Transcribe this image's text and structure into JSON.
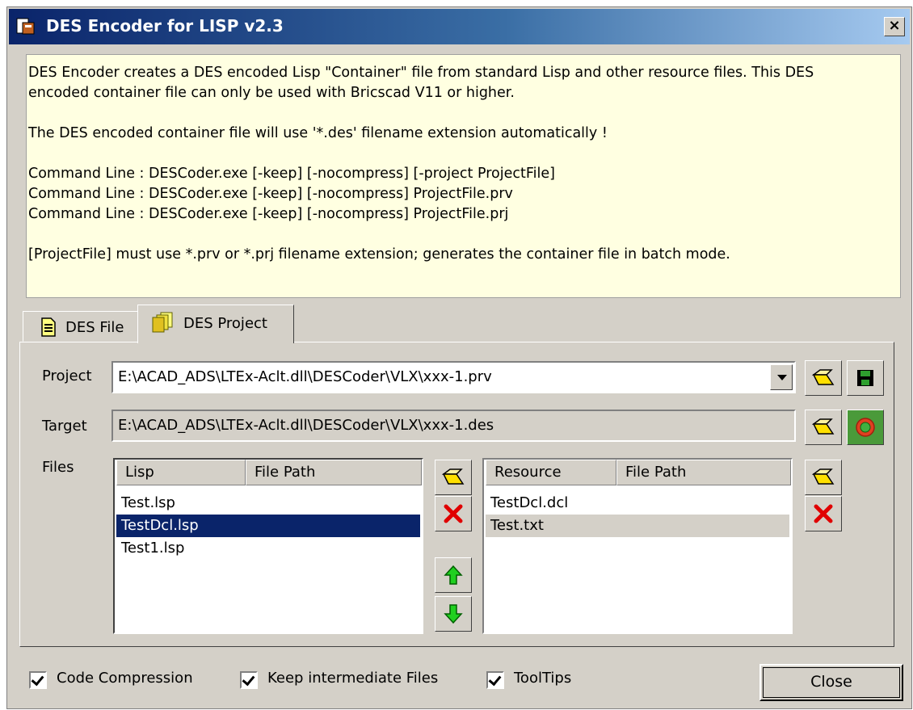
{
  "window": {
    "title": "DES Encoder for LISP v2.3",
    "close_glyph": "×"
  },
  "info": {
    "lines": [
      "DES Encoder creates a DES encoded Lisp \"Container\" file from standard Lisp and other resource files. This DES",
      "encoded container file can only be used with Bricscad V11 or higher.",
      "The DES encoded container file will use '*.des' filename extension automatically !",
      "Command Line : DESCoder.exe [-keep] [-nocompress] [-project  ProjectFile]",
      "Command Line : DESCoder.exe [-keep] [-nocompress] ProjectFile.prv",
      "Command Line : DESCoder.exe [-keep] [-nocompress] ProjectFile.prj",
      "[ProjectFile] must use *.prv or *.prj filename extension; generates the container file in batch mode."
    ]
  },
  "tabs": [
    {
      "label": "DES File",
      "icon": "document-icon",
      "active": false
    },
    {
      "label": "DES Project",
      "icon": "stacked-files-icon",
      "active": true
    }
  ],
  "project": {
    "project_label": "Project",
    "project_value": "E:\\ACAD_ADS\\LTEx-Aclt.dll\\DESCoder\\VLX\\xxx-1.prv",
    "target_label": "Target",
    "target_value": "E:\\ACAD_ADS\\LTEx-Aclt.dll\\DESCoder\\VLX\\xxx-1.des",
    "files_label": "Files"
  },
  "lisp_list": {
    "headers": [
      "Lisp",
      "File Path"
    ],
    "rows": [
      "Test.lsp",
      "TestDcl.lsp",
      "Test1.lsp"
    ],
    "selected_row": "TestDcl.lsp"
  },
  "resource_list": {
    "headers": [
      "Resource",
      "File Path"
    ],
    "rows": [
      "TestDcl.dcl",
      "Test.txt"
    ],
    "highlighted_row": "Test.txt"
  },
  "options": {
    "code_compression": {
      "label": "Code Compression",
      "checked": true
    },
    "keep_files": {
      "label": "Keep intermediate Files",
      "checked": true
    },
    "tooltips": {
      "label": "ToolTips",
      "checked": true
    }
  },
  "close_button": "Close",
  "colors": {
    "title_start": "#0a246a",
    "info_bg": "#ffffe1",
    "selection": "#0a246a",
    "face": "#d4d0c8"
  }
}
